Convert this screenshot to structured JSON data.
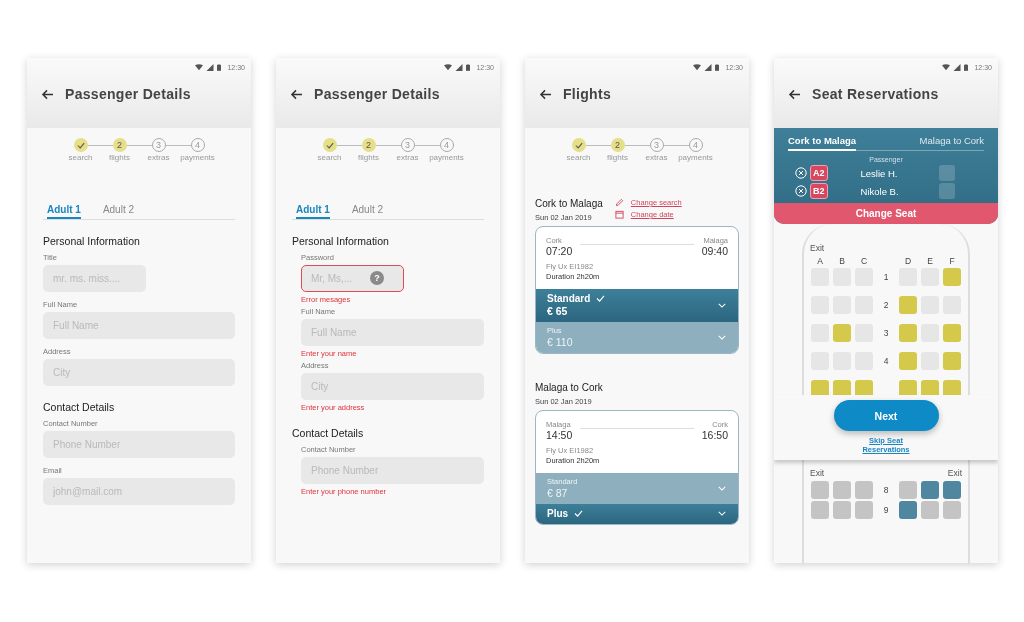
{
  "screens": [
    {
      "kind": "form",
      "status_time": "12:30",
      "title": "Passenger Details",
      "steps": [
        {
          "label": "search",
          "done": true,
          "current": false
        },
        {
          "label": "flights",
          "number": "2",
          "done": false,
          "current": true
        },
        {
          "label": "extras",
          "number": "3",
          "done": false,
          "current": false
        },
        {
          "label": "payments",
          "number": "4",
          "done": false,
          "current": false
        }
      ],
      "tabs": [
        {
          "label": "Adult 1",
          "selected": true
        },
        {
          "label": "Adult 2",
          "selected": false
        }
      ],
      "sections": [
        {
          "title": "Personal Information",
          "fields": [
            {
              "label": "Title",
              "placeholder": "mr. ms. miss....",
              "short": true,
              "invalid": false
            },
            {
              "label": "Full Name",
              "placeholder": "Full Name",
              "short": false,
              "invalid": false
            },
            {
              "label": "Address",
              "placeholder": "City",
              "short": false,
              "invalid": false
            }
          ]
        },
        {
          "title": "Contact Details",
          "fields": [
            {
              "label": "Contact Number",
              "placeholder": "Phone Number",
              "short": false,
              "invalid": false
            },
            {
              "label": "Email",
              "placeholder": "john@mail.com",
              "short": false,
              "invalid": false
            }
          ]
        }
      ]
    },
    {
      "kind": "form",
      "status_time": "12:30",
      "title": "Passenger Details",
      "steps": [
        {
          "label": "search",
          "done": true,
          "current": false
        },
        {
          "label": "flights",
          "number": "2",
          "done": false,
          "current": true
        },
        {
          "label": "extras",
          "number": "3",
          "done": false,
          "current": false
        },
        {
          "label": "payments",
          "number": "4",
          "done": false,
          "current": false
        }
      ],
      "tabs": [
        {
          "label": "Adult 1",
          "selected": true
        },
        {
          "label": "Adult 2",
          "selected": false
        }
      ],
      "sections": [
        {
          "title": "Personal Information",
          "fields": [
            {
              "label": "Password",
              "placeholder": "Mr, Ms,...",
              "help": "?",
              "error": "Error mesages",
              "short": true,
              "invalid": true
            },
            {
              "label": "Full Name",
              "placeholder": "Full Name",
              "error": "Enter your name",
              "short": false,
              "invalid": false
            },
            {
              "label": "Address",
              "placeholder": "City",
              "error": "Enter your address",
              "short": false,
              "invalid": false
            }
          ]
        },
        {
          "title": "Contact Details",
          "fields": [
            {
              "label": "Contact Number",
              "placeholder": "Phone Number",
              "error": "Enter your phone number",
              "short": false,
              "invalid": false
            }
          ]
        }
      ]
    },
    {
      "kind": "flights",
      "status_time": "12:30",
      "title": "Flights",
      "steps": [
        {
          "label": "search",
          "done": true,
          "current": false
        },
        {
          "label": "flights",
          "number": "2",
          "done": false,
          "current": true
        },
        {
          "label": "extras",
          "number": "3",
          "done": false,
          "current": false
        },
        {
          "label": "payments",
          "number": "4",
          "done": false,
          "current": false
        }
      ],
      "legs": [
        {
          "title": "Cork to Malaga",
          "date": "Sun 02 Jan 2019",
          "links": [
            {
              "label": "Change search"
            },
            {
              "label": "Change date"
            }
          ],
          "card": {
            "from": "Cork",
            "departure": "07:20",
            "to": "Malaga",
            "arrival": "09:40",
            "flight": "Fly Ux  EI1982",
            "duration": "Duration 2h20m",
            "fares": [
              {
                "name": "Standard",
                "price": "€ 65",
                "selected": true
              },
              {
                "name": "Plus",
                "price": "€ 110",
                "selected": false
              }
            ]
          }
        },
        {
          "title": "Malaga to Cork",
          "date": "Sun 02 Jan 2019",
          "card": {
            "from": "Malaga",
            "departure": "14:50",
            "to": "Cork",
            "arrival": "16:50",
            "flight": "Fly Ux  EI1982",
            "duration": "Duration 2h20m",
            "fares": [
              {
                "name": "Standard",
                "price": "€ 87",
                "selected": false
              },
              {
                "name": "Plus",
                "selected": true
              }
            ]
          }
        }
      ]
    },
    {
      "kind": "seats",
      "status_time": "12:30",
      "title": "Seat Reservations",
      "routes": [
        {
          "label": "Cork to Malaga",
          "selected": true
        },
        {
          "label": "Malaga to Cork",
          "selected": false
        }
      ],
      "passenger_heading": "Passenger",
      "passengers": [
        {
          "seat": "A2",
          "name": "Leslie H."
        },
        {
          "seat": "B2",
          "name": "Nikole B."
        }
      ],
      "change_button": "Change Seat",
      "upper_map": {
        "exit_label": "Exit",
        "columns": [
          "A",
          "B",
          "C",
          "D",
          "E",
          "F"
        ],
        "rows": [
          {
            "number": "1",
            "seats": [
              {
                "kind": "open"
              },
              {
                "kind": "open"
              },
              {
                "kind": "open"
              },
              {
                "kind": "open"
              },
              {
                "kind": "open"
              },
              {
                "kind": "picked"
              }
            ]
          },
          {
            "number": "2",
            "seats": [
              {
                "kind": "open"
              },
              {
                "kind": "open"
              },
              {
                "kind": "open"
              },
              {
                "kind": "picked"
              },
              {
                "kind": "open"
              },
              {
                "kind": "open"
              }
            ]
          },
          {
            "number": "3",
            "seats": [
              {
                "kind": "open"
              },
              {
                "kind": "picked"
              },
              {
                "kind": "open"
              },
              {
                "kind": "picked"
              },
              {
                "kind": "open"
              },
              {
                "kind": "picked"
              }
            ]
          },
          {
            "number": "4",
            "seats": [
              {
                "kind": "open"
              },
              {
                "kind": "open"
              },
              {
                "kind": "open"
              },
              {
                "kind": "picked"
              },
              {
                "kind": "open"
              },
              {
                "kind": "picked"
              }
            ]
          },
          {
            "seats": [
              {
                "kind": "picked"
              },
              {
                "kind": "picked"
              },
              {
                "kind": "picked"
              },
              {
                "kind": "picked"
              },
              {
                "kind": "picked"
              },
              {
                "kind": "picked"
              }
            ]
          }
        ]
      },
      "next_button": "Next",
      "skip_link": "Skip Seat Reservations",
      "lower_map": {
        "exit_labels": [
          "Exit",
          "Exit"
        ],
        "rows": [
          {
            "number": "8",
            "seats": [
              {
                "kind": "blocked"
              },
              {
                "kind": "blocked"
              },
              {
                "kind": "blocked"
              },
              {
                "kind": "blocked"
              },
              {
                "kind": "booked"
              },
              {
                "kind": "booked"
              }
            ]
          },
          {
            "number": "9",
            "seats": [
              {
                "kind": "blocked"
              },
              {
                "kind": "blocked"
              },
              {
                "kind": "blocked"
              },
              {
                "kind": "booked"
              },
              {
                "kind": "blocked"
              },
              {
                "kind": "blocked"
              }
            ]
          }
        ]
      }
    }
  ]
}
